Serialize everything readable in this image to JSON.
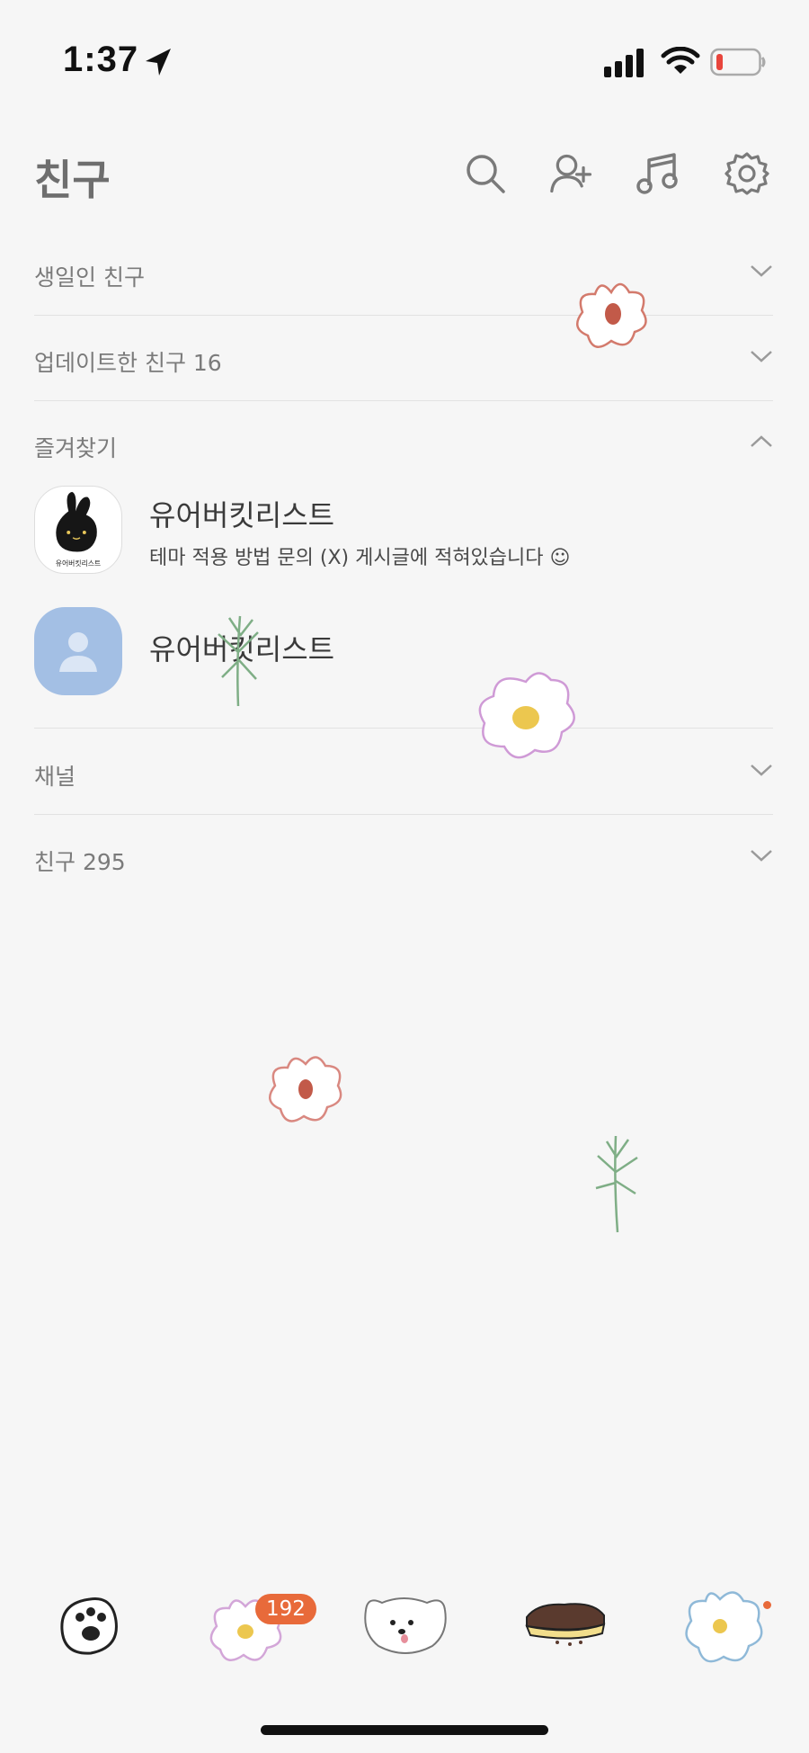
{
  "status": {
    "time": "1:37"
  },
  "header": {
    "title": "친구"
  },
  "sections": {
    "birthday": "생일인 친구",
    "updated": "업데이트한 친구 16",
    "favorites": "즐겨찾기",
    "channel": "채널",
    "friends": "친구 295"
  },
  "favorites": [
    {
      "name": "유어버킷리스트",
      "message": "테마 적용 방법 문의 (X) 게시글에 적혀있습니다 ☺"
    },
    {
      "name": "유어버킷리스트"
    }
  ],
  "tabbar": {
    "badge": "192"
  },
  "icons": [
    "location-arrow-icon",
    "signal-icon",
    "wifi-icon",
    "battery-icon",
    "search-icon",
    "add-friend-icon",
    "music-icon",
    "gear-icon",
    "chevron-down-icon",
    "chevron-up-icon"
  ],
  "colors": {
    "background": "#f6f6f6",
    "badge": "#e86a3a",
    "default_avatar": "#a3bfe4"
  }
}
